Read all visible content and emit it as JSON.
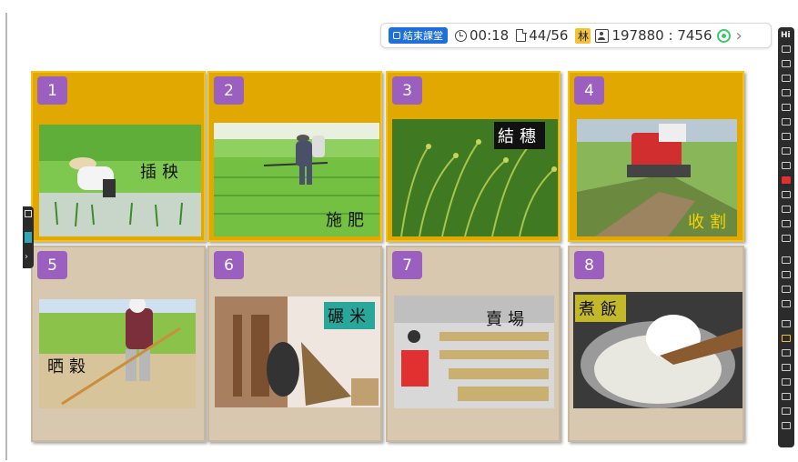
{
  "toolbar": {
    "end_class_label": "結束課堂",
    "timer": "00:18",
    "page": "44/56",
    "teacher_initial": "林",
    "meeting_id": "197880 : 7456"
  },
  "cards": [
    {
      "number": "1",
      "caption": "插秧"
    },
    {
      "number": "2",
      "caption": "施肥"
    },
    {
      "number": "3",
      "caption": "結穗"
    },
    {
      "number": "4",
      "caption": "收割"
    },
    {
      "number": "5",
      "caption": "晒穀"
    },
    {
      "number": "6",
      "caption": "碾米"
    },
    {
      "number": "7",
      "caption": "賣場"
    },
    {
      "number": "8",
      "caption": "煮飯"
    }
  ],
  "right_toolbar": {
    "label": "Hi"
  },
  "colors": {
    "gold": "#e0a800",
    "beige": "#d9c8b0",
    "badge": "#9b5fc0",
    "end_button": "#1e6fd9",
    "signal": "#3cc86b"
  }
}
